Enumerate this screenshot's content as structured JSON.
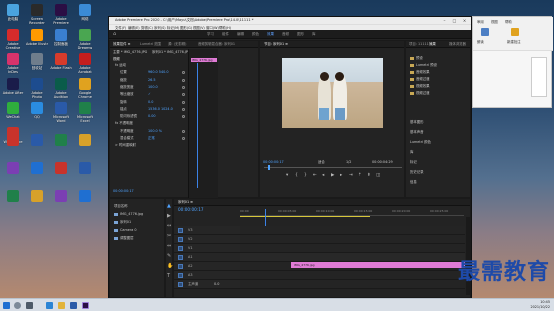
{
  "desktop": {
    "icons": [
      {
        "label": "此电脑",
        "color": "#4aa3df"
      },
      {
        "label": "Screen Recorder",
        "color": "#2a2a2a"
      },
      {
        "label": "Adobe Premiere",
        "color": "#2b0e44"
      },
      {
        "label": "网络",
        "color": "#3b8bd6"
      },
      {
        "label": "Adobe Creative",
        "color": "#d52b2b"
      },
      {
        "label": "Adobe Illustr",
        "color": "#ff9a00"
      },
      {
        "label": "控制面板",
        "color": "#3a7fd0"
      },
      {
        "label": "Adobe Dreamw",
        "color": "#4aa651"
      },
      {
        "label": "Adobe InDes",
        "color": "#d7336b"
      },
      {
        "label": "回收站",
        "color": "#6f7d8c"
      },
      {
        "label": "Adobe Flash",
        "color": "#d73b2b"
      },
      {
        "label": "Adobe Acrobat",
        "color": "#c41e1e"
      },
      {
        "label": "Adobe After",
        "color": "#1a1c4a"
      },
      {
        "label": "Adobe Photo",
        "color": "#1d4c8f"
      },
      {
        "label": "Adobe Audition",
        "color": "#0a5c4a"
      },
      {
        "label": "Google Chrome",
        "color": "#e0a21f"
      },
      {
        "label": "WeChat",
        "color": "#2fae3d"
      },
      {
        "label": "QQ",
        "color": "#2a8ce0"
      },
      {
        "label": "Microsoft Word",
        "color": "#2a5aa8"
      },
      {
        "label": "Microsoft Excel",
        "color": "#20804a"
      },
      {
        "label": "WPS Office",
        "color": "#c8332b"
      }
    ]
  },
  "premiere": {
    "title": "Adobe Premiere Pro 2020 - C:\\用户\\Mayu\\文档\\Adobe\\Premiere Pro\\14.0\\11111 *",
    "menu": [
      "文件(F)",
      "编辑(E)",
      "剪辑(C)",
      "序列(S)",
      "标记(M)",
      "图形(G)",
      "视图(V)",
      "窗口(W)",
      "帮助(H)"
    ],
    "workspaces": [
      "学习",
      "组件",
      "编辑",
      "颜色",
      "效果",
      "音频",
      "图形",
      "库"
    ],
    "active_workspace": "效果",
    "effect_controls": {
      "tabs": [
        "效果控件 ≡",
        "Lumetri 范围",
        "源: (无剪辑)",
        "音频剪辑混合器: 序列01"
      ],
      "source_line": "主要 * IMG_4776.JPG",
      "sequence_line": "序列01 * IMG_4776.JPG",
      "section_video": "视频",
      "rows": [
        {
          "label": "fx 运动",
          "value": ""
        },
        {
          "label": "位置",
          "value": "960.0  540.0"
        },
        {
          "label": "缩放",
          "value": "26.5"
        },
        {
          "label": "缩放宽度",
          "value": "100.0"
        },
        {
          "label": "等比缩放",
          "value": "✓"
        },
        {
          "label": "旋转",
          "value": "0.0"
        },
        {
          "label": "锚点",
          "value": "1536.0  1024.0"
        },
        {
          "label": "防闪烁滤镜",
          "value": "0.00"
        },
        {
          "label": "fx 不透明度",
          "value": ""
        },
        {
          "label": "不透明度",
          "value": "100.0 %"
        },
        {
          "label": "混合模式",
          "value": "正常"
        },
        {
          "label": "> 时间重映射",
          "value": ""
        }
      ],
      "clip_label": "IMG_4776.jpg",
      "timecode": "00:00:00:17"
    },
    "program": {
      "tab": "节目: 序列01 ≡",
      "timecode_left": "00:00:00:17",
      "fit": "适合",
      "quality": "1/2",
      "timecode_right": "00:00:04:29"
    },
    "project": {
      "tabs": [
        "项目: 11111 ≡",
        "效果",
        "媒体浏览器"
      ],
      "items": [
        "预设",
        "Lumetri 预设",
        "音频效果",
        "音频过渡",
        "视频效果",
        "视频过渡"
      ],
      "lower": [
        "基本图形",
        "基本声音",
        "Lumetri 颜色",
        "库",
        "标记",
        "历史记录",
        "信息"
      ]
    },
    "timeline": {
      "tab": "序列01 ≡",
      "timecode": "00:00:00:17",
      "ruler": [
        "00:00",
        "00:00:05:00",
        "00:00:10:00",
        "00:00:15:00",
        "00:00:20:00",
        "00:00:25:00"
      ],
      "tracks": [
        "V3",
        "V2",
        "V1",
        "A1",
        "A2",
        "A3",
        "主声道"
      ],
      "clip_label": "IMG_4776.jpg",
      "master_value": "0.0"
    },
    "media_panel": {
      "items": [
        "项目名称",
        "IMG_4776.jpg",
        "序列01",
        "Camera 0",
        "调整图层"
      ]
    }
  },
  "doc_window": {
    "labels": [
      "审阅",
      "视图",
      "帮助",
      "朗读",
      "新建批注"
    ]
  },
  "watermark": "最需教育",
  "clock": {
    "time": "10:45",
    "date": "2021/10/22"
  }
}
